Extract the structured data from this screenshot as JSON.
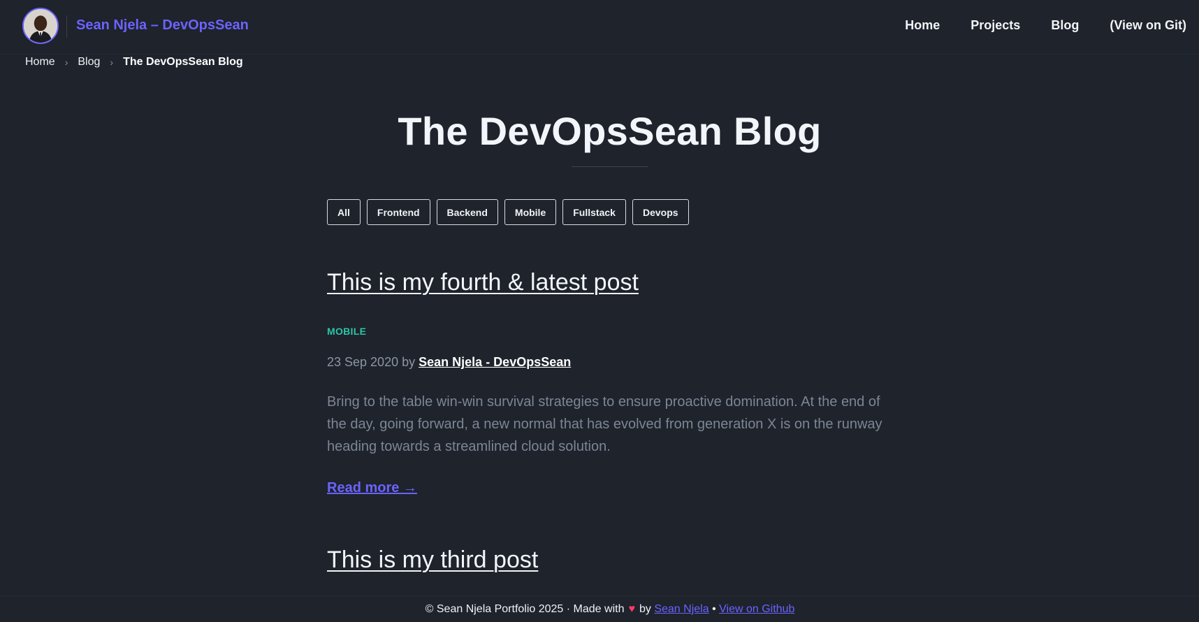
{
  "header": {
    "brand": "Sean Njela – DevOpsSean",
    "nav": [
      "Home",
      "Projects",
      "Blog",
      "(View on Git)"
    ]
  },
  "breadcrumb": {
    "items": [
      "Home",
      "Blog"
    ],
    "current": "The DevOpsSean Blog"
  },
  "page": {
    "title": "The DevOpsSean Blog"
  },
  "filters": [
    "All",
    "Frontend",
    "Backend",
    "Mobile",
    "Fullstack",
    "Devops"
  ],
  "posts": [
    {
      "title": "This is my fourth & latest post",
      "tag": "MOBILE",
      "date": "23 Sep 2020",
      "by": "by",
      "author": "Sean Njela - DevOpsSean",
      "excerpt": "Bring to the table win-win survival strategies to ensure proactive domination. At the end of the day, going forward, a new normal that has evolved from generation X is on the runway heading towards a streamlined cloud solution.",
      "read_more": "Read more →"
    },
    {
      "title": "This is my third post"
    }
  ],
  "footer": {
    "text": "© Sean Njela Portfolio 2025 · Made with",
    "heart": "♥",
    "by": "by",
    "author_link": "Sean Njela",
    "bullet": "•",
    "github_link": "View on Github"
  },
  "colors": {
    "accent": "#6c63ff",
    "tag": "#2ec4a6",
    "background": "#1e232c"
  }
}
